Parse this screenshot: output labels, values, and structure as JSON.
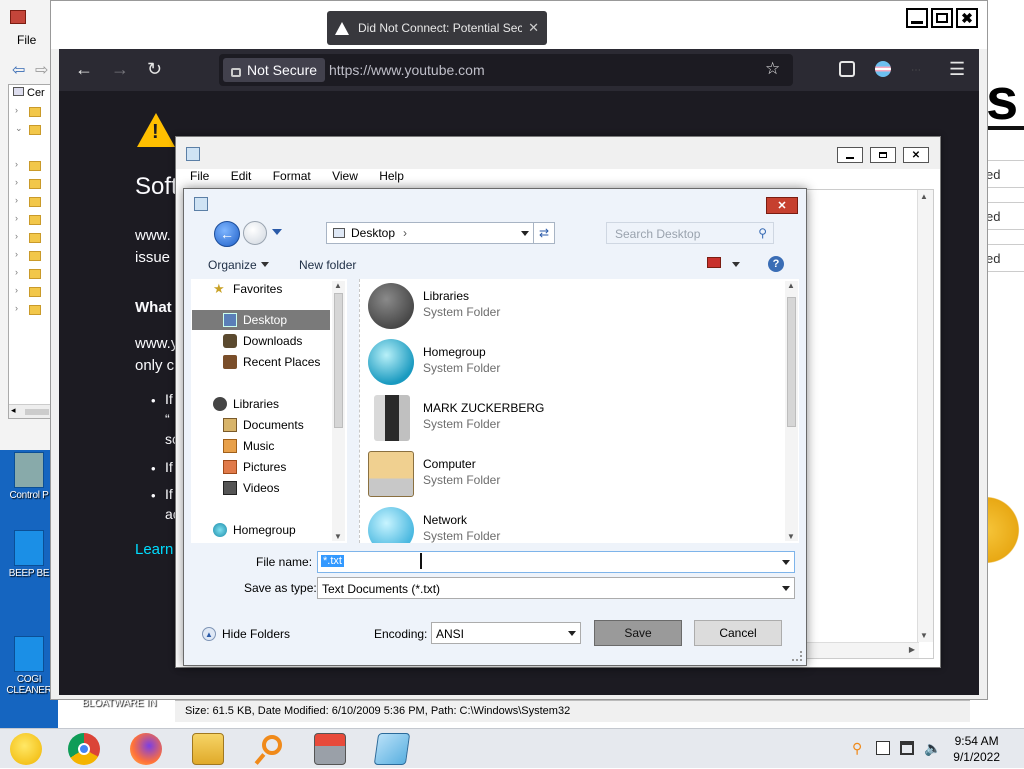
{
  "background_app": {
    "file_menu": "File",
    "tree_label": "Cer"
  },
  "right_window": {
    "big_text": "s",
    "rows": [
      "ed",
      "ed",
      "ed"
    ]
  },
  "desktop": {
    "icons": [
      "Control P",
      "BEEP BE",
      "COGI CLEANER",
      "BLOATWARE IN"
    ]
  },
  "browser": {
    "tab_alert": "Did Not Connect: Potential Security Issue",
    "not_secure": "Not Secure",
    "url": "https://www.youtube.com",
    "page": {
      "heading": "Soft",
      "para1_line1": "www.",
      "para1_line2": "issue",
      "what_heading": "What",
      "para2_line1": "www.y",
      "para2_line2": "only c",
      "bullet1_a": "If",
      "bullet1_b": "“",
      "bullet1_c": "sc",
      "bullet2": "If",
      "bullet3_a": "If",
      "bullet3_b": "ac",
      "learn": "Learn"
    }
  },
  "notepad": {
    "menu": [
      "File",
      "Edit",
      "Format",
      "View",
      "Help"
    ],
    "status": "Size: 61.5 KB, Date Modified: 6/10/2009 5:36 PM, Path: C:\\Windows\\System32"
  },
  "dialog": {
    "address": "Desktop",
    "search_placeholder": "Search Desktop",
    "toolbar": {
      "organize": "Organize",
      "new_folder": "New folder"
    },
    "nav_items": [
      {
        "label": "Favorites",
        "icon": "star-icon",
        "color": "#e8c44a"
      },
      {
        "label": "Desktop",
        "icon": "desktop-icon",
        "color": "#5a7fb8"
      },
      {
        "label": "Downloads",
        "icon": "downloads-icon",
        "color": "#5b4a2f"
      },
      {
        "label": "Recent Places",
        "icon": "recent-places-icon",
        "color": "#7a4e2a"
      },
      {
        "label": "Libraries",
        "icon": "libraries-icon",
        "color": "#555555"
      },
      {
        "label": "Documents",
        "icon": "documents-icon",
        "color": "#7a5a2a"
      },
      {
        "label": "Music",
        "icon": "music-icon",
        "color": "#d07a2a"
      },
      {
        "label": "Pictures",
        "icon": "pictures-icon",
        "color": "#c05a2a"
      },
      {
        "label": "Videos",
        "icon": "videos-icon",
        "color": "#4a4a4a"
      },
      {
        "label": "Homegroup",
        "icon": "homegroup-icon",
        "color": "#2aa0b8"
      }
    ],
    "files": [
      {
        "name": "Libraries",
        "type": "System Folder",
        "icon": "libraries-folder-icon"
      },
      {
        "name": "Homegroup",
        "type": "System Folder",
        "icon": "homegroup-folder-icon"
      },
      {
        "name": "MARK ZUCKERBERG",
        "type": "System Folder",
        "icon": "user-folder-icon"
      },
      {
        "name": "Computer",
        "type": "System Folder",
        "icon": "computer-folder-icon"
      },
      {
        "name": "Network",
        "type": "System Folder",
        "icon": "network-folder-icon"
      }
    ],
    "file_name_label": "File name:",
    "file_name_value": "*.txt",
    "save_type_label": "Save as type:",
    "save_type_value": "Text Documents (*.txt)",
    "hide_folders": "Hide Folders",
    "encoding_label": "Encoding:",
    "encoding_value": "ANSI",
    "save_button": "Save",
    "cancel_button": "Cancel"
  },
  "taskbar": {
    "apps": [
      "smiley-icon",
      "chrome-icon",
      "firefox-icon",
      "folder-icon",
      "search-app-icon",
      "toolbox-icon",
      "notepad-app-icon"
    ],
    "time": "9:54 AM",
    "date": "9/1/2022"
  }
}
